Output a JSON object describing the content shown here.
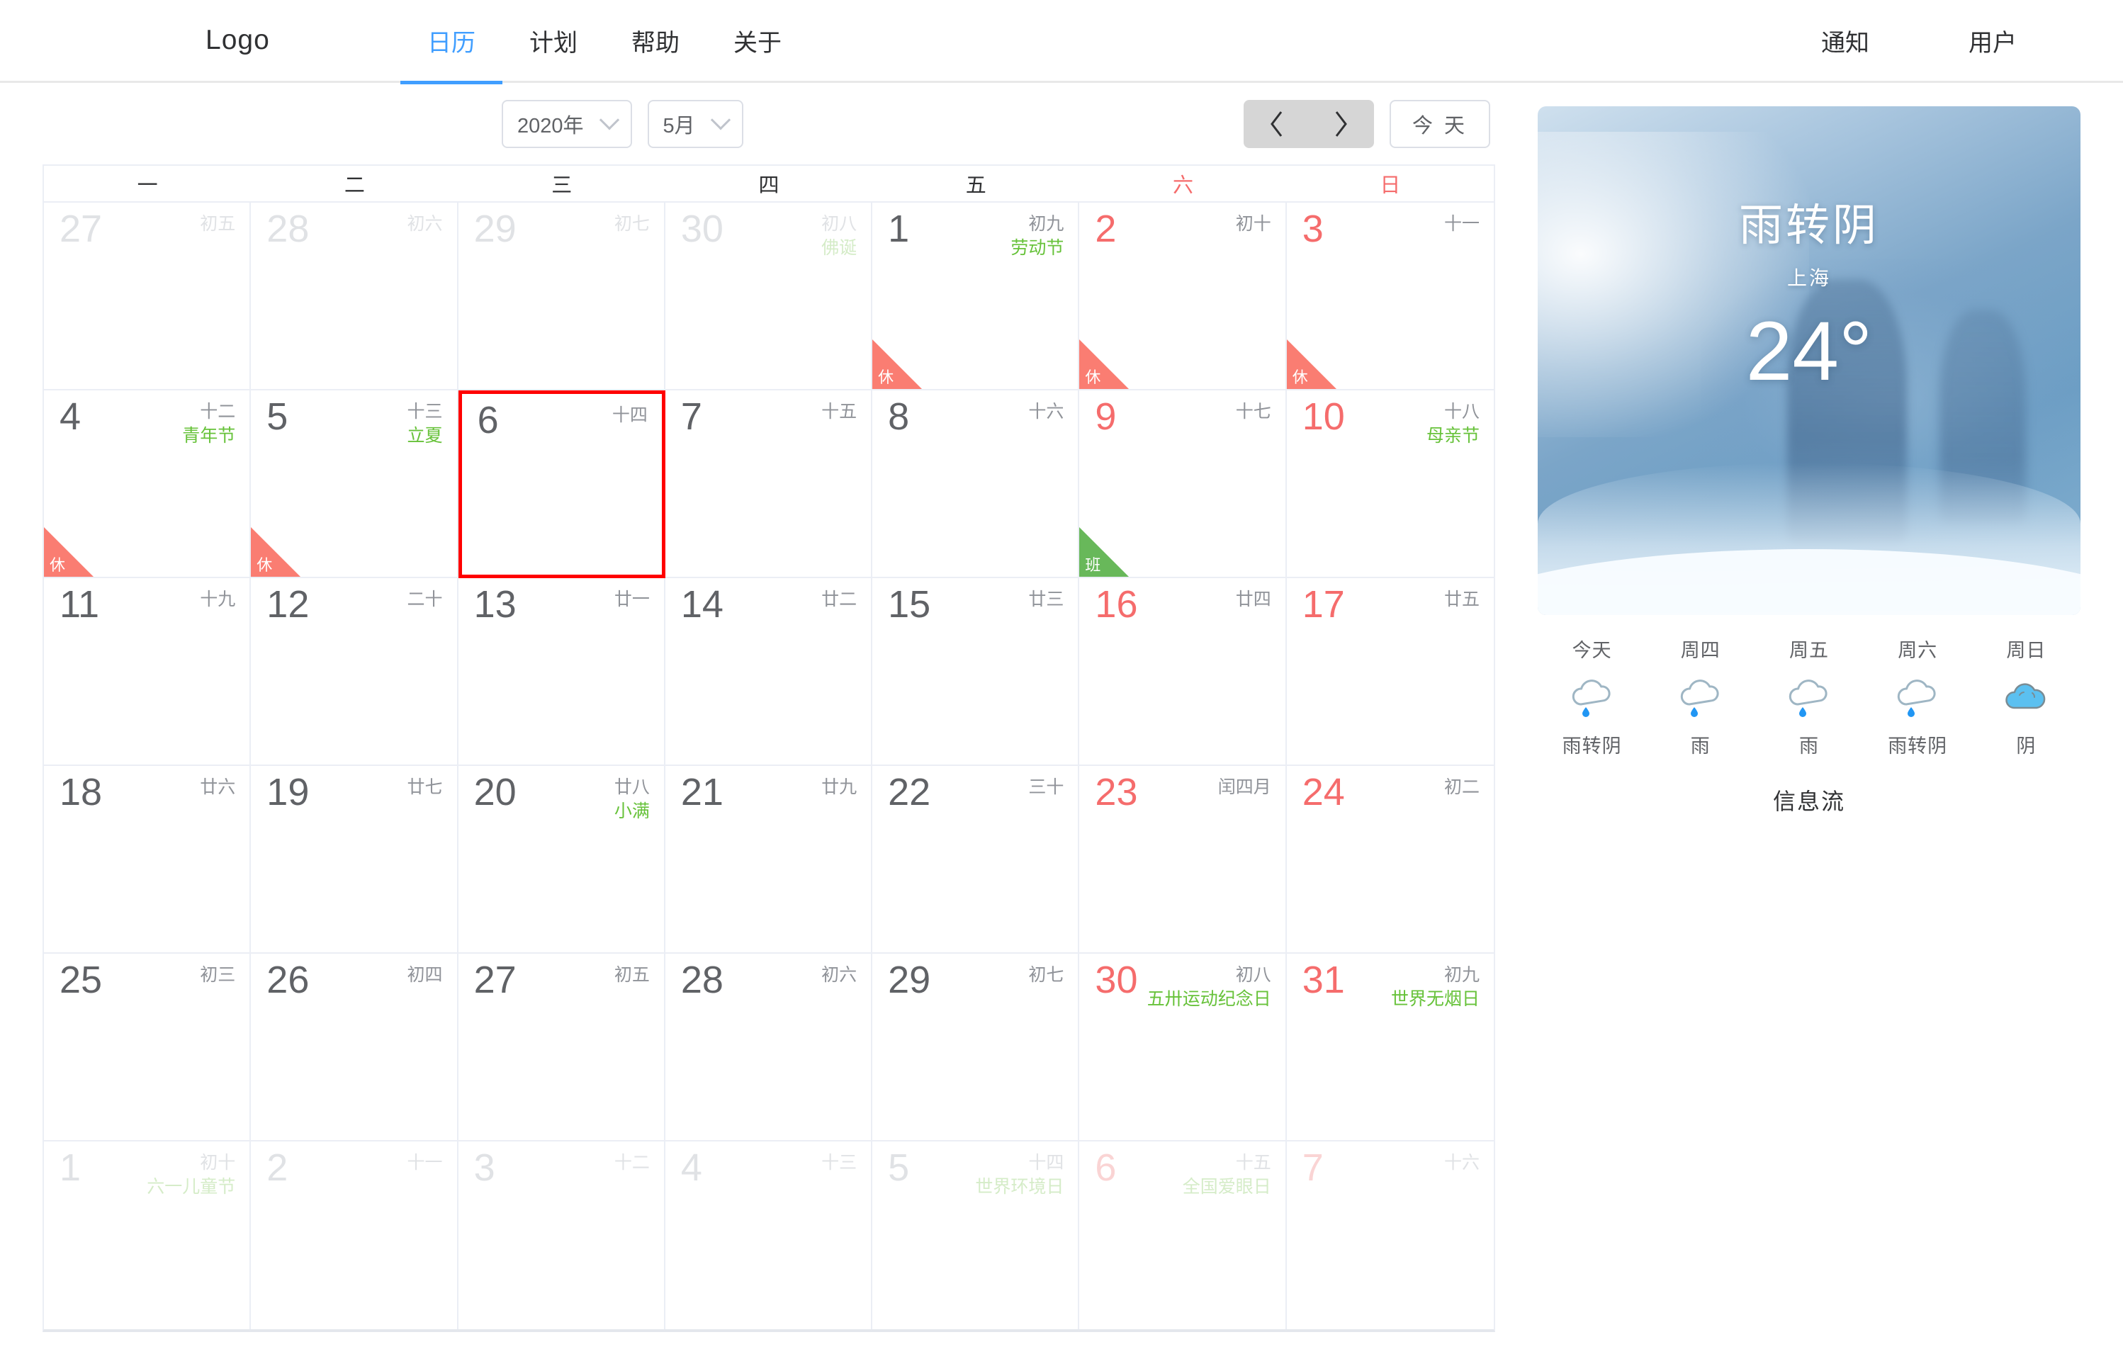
{
  "header": {
    "logo": "Logo",
    "nav": [
      {
        "label": "日历",
        "active": true
      },
      {
        "label": "计划",
        "active": false
      },
      {
        "label": "帮助",
        "active": false
      },
      {
        "label": "关于",
        "active": false
      }
    ],
    "notifications_label": "通知",
    "user_label": "用户"
  },
  "toolbar": {
    "year": "2020年",
    "month": "5月",
    "prev_label": "‹",
    "next_label": "›",
    "today_label": "今 天"
  },
  "calendar": {
    "weekdays": [
      "一",
      "二",
      "三",
      "四",
      "五",
      "六",
      "日"
    ],
    "weekend_indices": [
      5,
      6
    ],
    "days": [
      {
        "num": "27",
        "lunar": "初五",
        "event": "",
        "other": true,
        "weekend": false,
        "flag": "",
        "selected": false
      },
      {
        "num": "28",
        "lunar": "初六",
        "event": "",
        "other": true,
        "weekend": false,
        "flag": "",
        "selected": false
      },
      {
        "num": "29",
        "lunar": "初七",
        "event": "",
        "other": true,
        "weekend": false,
        "flag": "",
        "selected": false
      },
      {
        "num": "30",
        "lunar": "初八",
        "event": "佛诞",
        "other": true,
        "weekend": false,
        "flag": "",
        "selected": false
      },
      {
        "num": "1",
        "lunar": "初九",
        "event": "劳动节",
        "other": false,
        "weekend": false,
        "flag": "休",
        "selected": false
      },
      {
        "num": "2",
        "lunar": "初十",
        "event": "",
        "other": false,
        "weekend": true,
        "flag": "休",
        "selected": false
      },
      {
        "num": "3",
        "lunar": "十一",
        "event": "",
        "other": false,
        "weekend": true,
        "flag": "休",
        "selected": false
      },
      {
        "num": "4",
        "lunar": "十二",
        "event": "青年节",
        "other": false,
        "weekend": false,
        "flag": "休",
        "selected": false
      },
      {
        "num": "5",
        "lunar": "十三",
        "event": "立夏",
        "other": false,
        "weekend": false,
        "flag": "休",
        "selected": false
      },
      {
        "num": "6",
        "lunar": "十四",
        "event": "",
        "other": false,
        "weekend": false,
        "flag": "",
        "selected": true
      },
      {
        "num": "7",
        "lunar": "十五",
        "event": "",
        "other": false,
        "weekend": false,
        "flag": "",
        "selected": false
      },
      {
        "num": "8",
        "lunar": "十六",
        "event": "",
        "other": false,
        "weekend": false,
        "flag": "",
        "selected": false
      },
      {
        "num": "9",
        "lunar": "十七",
        "event": "",
        "other": false,
        "weekend": true,
        "flag": "班",
        "selected": false
      },
      {
        "num": "10",
        "lunar": "十八",
        "event": "母亲节",
        "other": false,
        "weekend": true,
        "flag": "",
        "selected": false
      },
      {
        "num": "11",
        "lunar": "十九",
        "event": "",
        "other": false,
        "weekend": false,
        "flag": "",
        "selected": false
      },
      {
        "num": "12",
        "lunar": "二十",
        "event": "",
        "other": false,
        "weekend": false,
        "flag": "",
        "selected": false
      },
      {
        "num": "13",
        "lunar": "廿一",
        "event": "",
        "other": false,
        "weekend": false,
        "flag": "",
        "selected": false
      },
      {
        "num": "14",
        "lunar": "廿二",
        "event": "",
        "other": false,
        "weekend": false,
        "flag": "",
        "selected": false
      },
      {
        "num": "15",
        "lunar": "廿三",
        "event": "",
        "other": false,
        "weekend": false,
        "flag": "",
        "selected": false
      },
      {
        "num": "16",
        "lunar": "廿四",
        "event": "",
        "other": false,
        "weekend": true,
        "flag": "",
        "selected": false
      },
      {
        "num": "17",
        "lunar": "廿五",
        "event": "",
        "other": false,
        "weekend": true,
        "flag": "",
        "selected": false
      },
      {
        "num": "18",
        "lunar": "廿六",
        "event": "",
        "other": false,
        "weekend": false,
        "flag": "",
        "selected": false
      },
      {
        "num": "19",
        "lunar": "廿七",
        "event": "",
        "other": false,
        "weekend": false,
        "flag": "",
        "selected": false
      },
      {
        "num": "20",
        "lunar": "廿八",
        "event": "小满",
        "other": false,
        "weekend": false,
        "flag": "",
        "selected": false
      },
      {
        "num": "21",
        "lunar": "廿九",
        "event": "",
        "other": false,
        "weekend": false,
        "flag": "",
        "selected": false
      },
      {
        "num": "22",
        "lunar": "三十",
        "event": "",
        "other": false,
        "weekend": false,
        "flag": "",
        "selected": false
      },
      {
        "num": "23",
        "lunar": "闰四月",
        "event": "",
        "other": false,
        "weekend": true,
        "flag": "",
        "selected": false
      },
      {
        "num": "24",
        "lunar": "初二",
        "event": "",
        "other": false,
        "weekend": true,
        "flag": "",
        "selected": false
      },
      {
        "num": "25",
        "lunar": "初三",
        "event": "",
        "other": false,
        "weekend": false,
        "flag": "",
        "selected": false
      },
      {
        "num": "26",
        "lunar": "初四",
        "event": "",
        "other": false,
        "weekend": false,
        "flag": "",
        "selected": false
      },
      {
        "num": "27",
        "lunar": "初五",
        "event": "",
        "other": false,
        "weekend": false,
        "flag": "",
        "selected": false
      },
      {
        "num": "28",
        "lunar": "初六",
        "event": "",
        "other": false,
        "weekend": false,
        "flag": "",
        "selected": false
      },
      {
        "num": "29",
        "lunar": "初七",
        "event": "",
        "other": false,
        "weekend": false,
        "flag": "",
        "selected": false
      },
      {
        "num": "30",
        "lunar": "初八",
        "event": "五卅运动纪念日",
        "other": false,
        "weekend": true,
        "flag": "",
        "selected": false
      },
      {
        "num": "31",
        "lunar": "初九",
        "event": "世界无烟日",
        "other": false,
        "weekend": true,
        "flag": "",
        "selected": false
      },
      {
        "num": "1",
        "lunar": "初十",
        "event": "六一儿童节",
        "other": true,
        "weekend": false,
        "flag": "",
        "selected": false
      },
      {
        "num": "2",
        "lunar": "十一",
        "event": "",
        "other": true,
        "weekend": false,
        "flag": "",
        "selected": false
      },
      {
        "num": "3",
        "lunar": "十二",
        "event": "",
        "other": true,
        "weekend": false,
        "flag": "",
        "selected": false
      },
      {
        "num": "4",
        "lunar": "十三",
        "event": "",
        "other": true,
        "weekend": false,
        "flag": "",
        "selected": false
      },
      {
        "num": "5",
        "lunar": "十四",
        "event": "世界环境日",
        "other": true,
        "weekend": false,
        "flag": "",
        "selected": false
      },
      {
        "num": "6",
        "lunar": "十五",
        "event": "全国爱眼日",
        "other": true,
        "weekend": true,
        "flag": "",
        "selected": false
      },
      {
        "num": "7",
        "lunar": "十六",
        "event": "",
        "other": true,
        "weekend": true,
        "flag": "",
        "selected": false
      }
    ]
  },
  "weather": {
    "condition": "雨转阴",
    "city": "上海",
    "temperature": "24°",
    "forecast": [
      {
        "day": "今天",
        "icon": "rain-cloud-icon",
        "desc": "雨转阴"
      },
      {
        "day": "周四",
        "icon": "rain-cloud-icon",
        "desc": "雨"
      },
      {
        "day": "周五",
        "icon": "rain-cloud-icon",
        "desc": "雨"
      },
      {
        "day": "周六",
        "icon": "rain-cloud-icon",
        "desc": "雨转阴"
      },
      {
        "day": "周日",
        "icon": "filled-cloud-icon",
        "desc": "阴"
      }
    ]
  },
  "infostream": {
    "title": "信息流"
  },
  "colors": {
    "accent": "#409eff",
    "weekend": "#f56c6c",
    "event": "#67c23a",
    "rest_flag": "#fa7d72",
    "work_flag": "#68b85a",
    "selection": "#ff0000"
  }
}
